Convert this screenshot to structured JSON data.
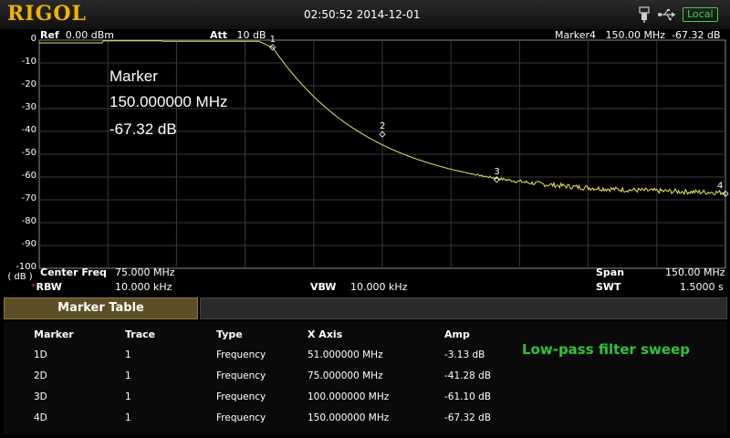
{
  "header": {
    "brand": "RIGOL",
    "datetime": "02:50:52 2014-12-01",
    "remote_status": "Local",
    "colors": {
      "brand": "#f0b400",
      "status": "#3cd43c"
    }
  },
  "plot": {
    "ref_label": "Ref",
    "ref_value": "0.00 dBm",
    "att_label": "Att",
    "att_value": "10 dB",
    "active_marker_label": "Marker4",
    "active_marker_freq": "150.00 MHz",
    "active_marker_amp": "-67.32 dB",
    "unit": "( dB )",
    "y_ticks": [
      "0",
      "-10",
      "-20",
      "-30",
      "-40",
      "-50",
      "-60",
      "-70",
      "-80",
      "-90",
      "-100"
    ],
    "big_marker": {
      "title": "Marker",
      "freq": "150.000000 MHz",
      "amp": "-67.32 dB"
    },
    "marker_labels": [
      "1",
      "2",
      "3",
      "4"
    ],
    "trace_color": "#e8e85a"
  },
  "settings": {
    "center_freq_label": "Center Freq",
    "center_freq_value": "75.000 MHz",
    "rbw_label": "RBW",
    "rbw_value": "10.000 kHz",
    "vbw_label": "VBW",
    "vbw_value": "10.000 kHz",
    "span_label": "Span",
    "span_value": "150.00 MHz",
    "swt_label": "SWT",
    "swt_value": "1.5000 s"
  },
  "marker_table": {
    "title": "Marker Table",
    "columns": [
      "Marker",
      "Trace",
      "Type",
      "X Axis",
      "Amp"
    ],
    "rows": [
      [
        "1D",
        "1",
        "Frequency",
        "51.000000 MHz",
        "-3.13 dB"
      ],
      [
        "2D",
        "1",
        "Frequency",
        "75.000000 MHz",
        "-41.28 dB"
      ],
      [
        "3D",
        "1",
        "Frequency",
        "100.000000 MHz",
        "-61.10 dB"
      ],
      [
        "4D",
        "1",
        "Frequency",
        "150.000000 MHz",
        "-67.32 dB"
      ]
    ],
    "note": "Low-pass filter sweep"
  }
}
